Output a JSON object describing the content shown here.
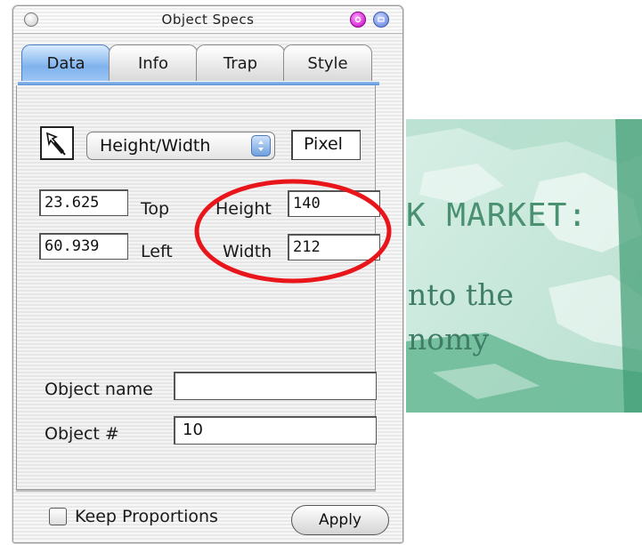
{
  "window": {
    "title": "Object Specs"
  },
  "tabs": [
    {
      "label": "Data",
      "active": true
    },
    {
      "label": "Info",
      "active": false
    },
    {
      "label": "Trap",
      "active": false
    },
    {
      "label": "Style",
      "active": false
    }
  ],
  "dimension_mode": {
    "selected": "Height/Width",
    "unit": "Pixel"
  },
  "position": {
    "top": {
      "value": "23.625",
      "label": "Top"
    },
    "left": {
      "value": "60.939",
      "label": "Left"
    }
  },
  "size": {
    "height": {
      "value": "140",
      "label": "Height"
    },
    "width": {
      "value": "212",
      "label": "Width"
    }
  },
  "object_name": {
    "label": "Object name",
    "value": ""
  },
  "object_number": {
    "label": "Object #",
    "value": "10"
  },
  "keep_proportions": {
    "label": "Keep Proportions",
    "checked": false
  },
  "apply_button": {
    "label": "Apply"
  },
  "background_image": {
    "headline": "K MARKET:",
    "line1": "nto the",
    "line2": "nomy"
  },
  "colors": {
    "active_tab": "#7fb2ec",
    "highlight_ellipse": "#e8151b",
    "banner_text": "#3f7d66"
  },
  "icons": {
    "tool": "pointer-tool-icon",
    "dropdown": "popup-arrows-icon",
    "close": "close-icon",
    "collapse": "collapse-icon",
    "zoom": "zoom-icon"
  }
}
